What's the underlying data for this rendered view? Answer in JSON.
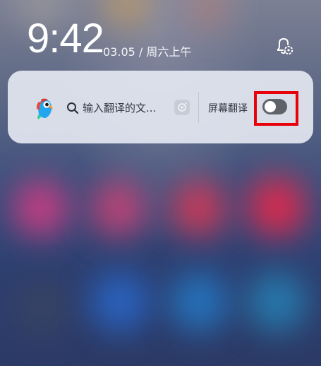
{
  "lockscreen": {
    "time": "9:42",
    "date": "03.05 / 周六上午",
    "notification_settings_icon": "bell-gear-icon"
  },
  "translate_widget": {
    "app_icon": "parrot-logo-icon",
    "search": {
      "icon": "search-icon",
      "placeholder": "输入翻译的文..."
    },
    "camera_icon": "camera-icon",
    "toggle": {
      "label": "屏幕翻译",
      "state": "off"
    }
  },
  "colors": {
    "highlight": "#e8000b",
    "toggle_off": "#5f6369",
    "card_background": "#e2e6f0"
  }
}
